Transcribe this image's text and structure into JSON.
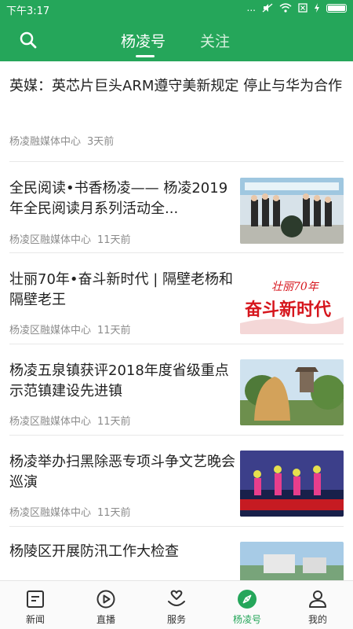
{
  "status": {
    "time": "下午3:17",
    "signal": "...",
    "battery_level": 1.0
  },
  "header": {
    "tabs": [
      {
        "label": "杨凌号",
        "active": true
      },
      {
        "label": "关注",
        "active": false
      }
    ]
  },
  "feed": [
    {
      "title": "英媒：英芯片巨头ARM遵守美新规定 停止与华为合作",
      "source": "杨凌融媒体中心",
      "ago": "3天前"
    },
    {
      "title": "全民阅读•书香杨凌—— 杨凌2019年全民阅读月系列活动全...",
      "source": "杨凌区融媒体中心",
      "ago": "11天前",
      "thumb": "launch-ceremony"
    },
    {
      "title": "壮丽70年•奋斗新时代 | 隔壁老杨和隔壁老王",
      "source": "杨凌区融媒体中心",
      "ago": "11天前",
      "thumb": "banner",
      "thumb_text_1": "壮丽70年",
      "thumb_text_2": "奋斗新时代"
    },
    {
      "title": "杨凌五泉镇获评2018年度省级重点示范镇建设先进镇",
      "source": "杨凌区融媒体中心",
      "ago": "11天前",
      "thumb": "town-stone"
    },
    {
      "title": "杨凌举办扫黑除恶专项斗争文艺晚会巡演",
      "source": "杨凌区融媒体中心",
      "ago": "11天前",
      "thumb": "stage-show"
    },
    {
      "title": "杨陵区开展防汛工作大检查",
      "thumb": "city-view"
    }
  ],
  "tabbar": [
    {
      "label": "新闻",
      "icon": "news-icon"
    },
    {
      "label": "直播",
      "icon": "play-icon"
    },
    {
      "label": "服务",
      "icon": "heart-hand-icon"
    },
    {
      "label": "杨凌号",
      "icon": "compass-icon",
      "active": true
    },
    {
      "label": "我的",
      "icon": "user-icon"
    }
  ],
  "colors": {
    "brand": "#25a65a",
    "text": "#222222",
    "meta": "#8c8c8c"
  }
}
